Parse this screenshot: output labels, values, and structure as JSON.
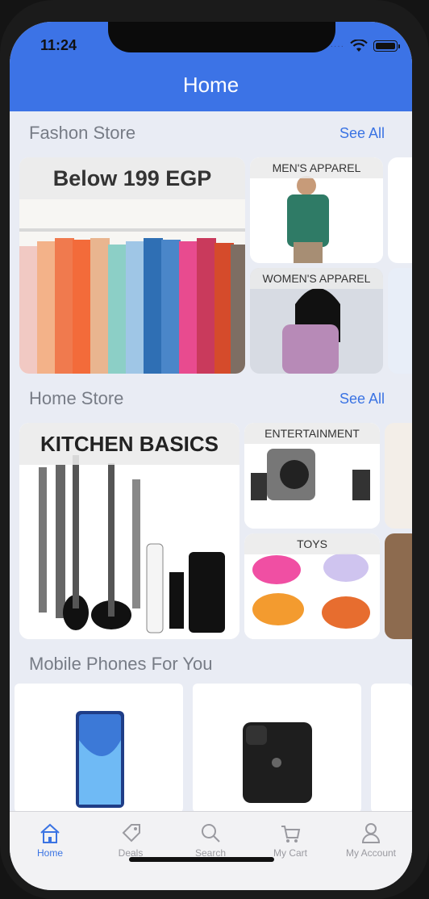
{
  "status": {
    "time": "11:24",
    "signal": "····"
  },
  "header": {
    "title": "Home"
  },
  "sections": {
    "fashion": {
      "title": "Fashon Store",
      "see_all": "See All",
      "banner": "Below 199 EGP",
      "tiles": [
        "MEN'S APPAREL",
        "WOMEN'S APPAREL"
      ]
    },
    "home": {
      "title": "Home Store",
      "see_all": "See All",
      "banner": "KITCHEN BASICS",
      "tiles": [
        "ENTERTAINMENT",
        "TOYS"
      ]
    },
    "mobile": {
      "title": "Mobile Phones For You"
    }
  },
  "tabs": [
    {
      "label": "Home",
      "icon": "home-icon",
      "active": true
    },
    {
      "label": "Deals",
      "icon": "tag-icon",
      "active": false
    },
    {
      "label": "Search",
      "icon": "search-icon",
      "active": false
    },
    {
      "label": "My Cart",
      "icon": "cart-icon",
      "active": false
    },
    {
      "label": "My Account",
      "icon": "person-icon",
      "active": false
    }
  ],
  "colors": {
    "accent": "#3a73e3",
    "header": "#3c73e6",
    "background": "#e9ecf4"
  }
}
